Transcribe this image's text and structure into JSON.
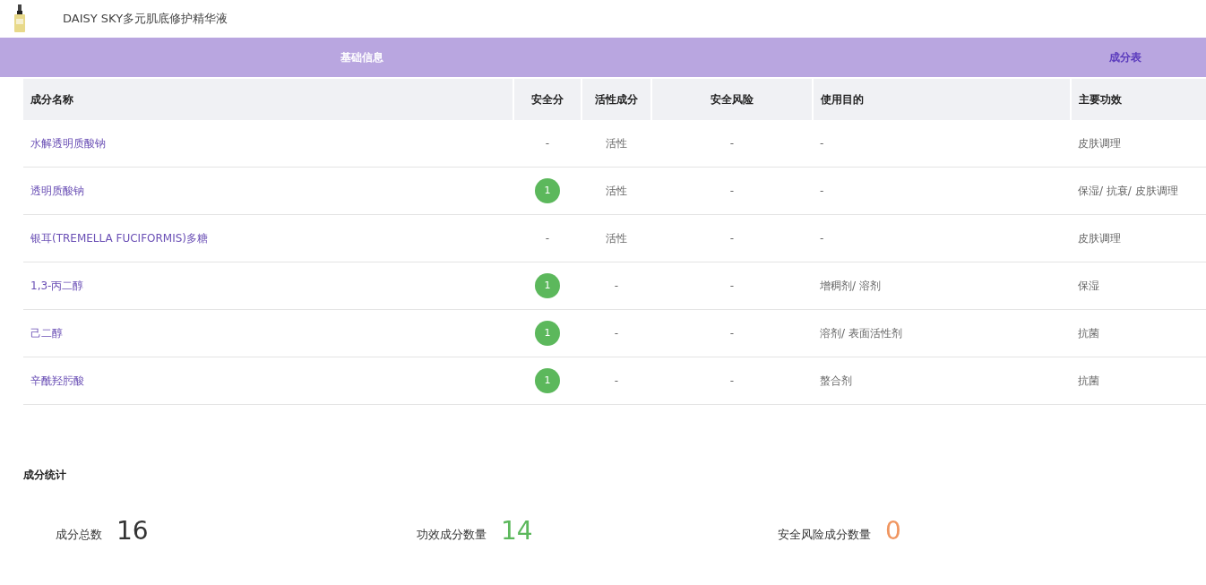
{
  "product": {
    "title": "DAISY SKY多元肌底修护精华液"
  },
  "tabs": [
    {
      "label": "基础信息",
      "selected": false
    },
    {
      "label": "成分表",
      "selected": true
    }
  ],
  "table": {
    "columns": [
      "成分名称",
      "安全分",
      "活性成分",
      "安全风险",
      "使用目的",
      "主要功效"
    ],
    "rows": [
      {
        "name": "水解透明质酸钠",
        "safety": {
          "kind": "text",
          "text": "-"
        },
        "active": "活性",
        "risk": "-",
        "purpose": "-",
        "effect": "皮肤调理"
      },
      {
        "name": "透明质酸钠",
        "safety": {
          "kind": "badge",
          "text": "1"
        },
        "active": "活性",
        "risk": "-",
        "purpose": "-",
        "effect": "保湿/ 抗衰/ 皮肤调理"
      },
      {
        "name": "银耳(TREMELLA FUCIFORMIS)多糖",
        "safety": {
          "kind": "text",
          "text": "-"
        },
        "active": "活性",
        "risk": "-",
        "purpose": "-",
        "effect": "皮肤调理"
      },
      {
        "name": "1,3-丙二醇",
        "safety": {
          "kind": "badge",
          "text": "1"
        },
        "active": "-",
        "risk": "-",
        "purpose": "增稠剂/ 溶剂",
        "effect": "保湿"
      },
      {
        "name": "己二醇",
        "safety": {
          "kind": "badge",
          "text": "1"
        },
        "active": "-",
        "risk": "-",
        "purpose": "溶剂/ 表面活性剂",
        "effect": "抗菌"
      },
      {
        "name": "辛酰羟肟酸",
        "safety": {
          "kind": "badge",
          "text": "1"
        },
        "active": "-",
        "risk": "-",
        "purpose": "螯合剂",
        "effect": "抗菌"
      }
    ]
  },
  "stats": {
    "title": "成分统计",
    "items": [
      {
        "label": "成分总数",
        "value": "16",
        "color": "#333333"
      },
      {
        "label": "功效成分数量",
        "value": "14",
        "color": "#5cb85c"
      },
      {
        "label": "安全风险成分数量",
        "value": "0",
        "color": "#f0955f"
      }
    ]
  }
}
